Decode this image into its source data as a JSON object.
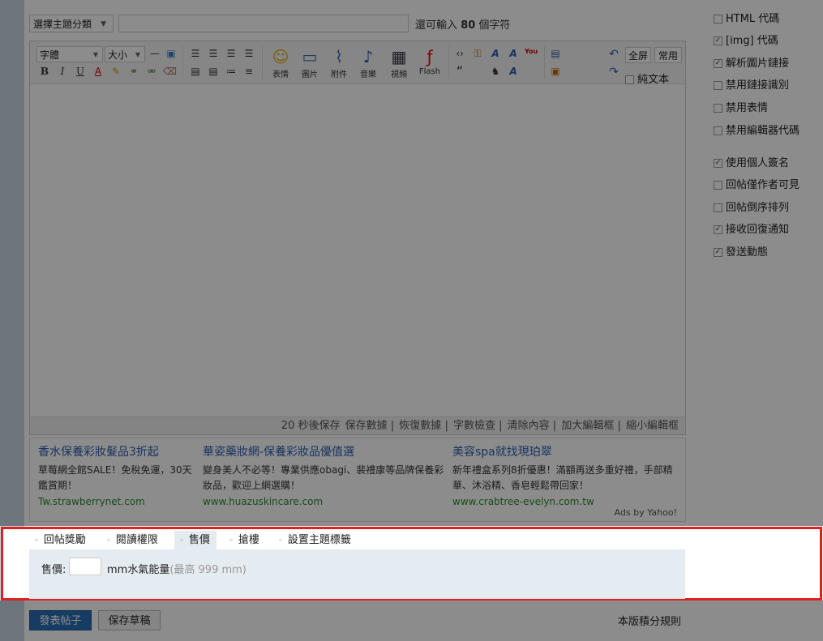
{
  "header": {
    "topic_select": "選擇主題分類",
    "char_remaining_prefix": "還可輸入",
    "char_remaining_count": "80",
    "char_remaining_suffix": "個字符"
  },
  "toolbar": {
    "font_select": "字體",
    "size_select": "大小",
    "buttons": [
      {
        "label": "表情",
        "icon": "smiley-icon"
      },
      {
        "label": "圖片",
        "icon": "image-icon"
      },
      {
        "label": "附件",
        "icon": "paperclip-icon"
      },
      {
        "label": "音樂",
        "icon": "music-note-icon"
      },
      {
        "label": "視頻",
        "icon": "video-icon"
      },
      {
        "label": "Flash",
        "icon": "flash-icon"
      }
    ],
    "fullscreen": "全屏",
    "common": "常用",
    "plain_text": "純文本"
  },
  "status_bar": {
    "autosave": "20 秒後保存",
    "save_data": "保存數據",
    "restore_data": "恢復數據",
    "word_check": "字數檢查",
    "clear_content": "清除內容",
    "enlarge": "加大編輯框",
    "shrink": "縮小編輯框"
  },
  "ads": [
    {
      "title": "香水保養彩妝髮品3折起",
      "desc": "草莓網全館SALE！免稅免運，30天鑑賞期！",
      "url": "Tw.strawberrynet.com"
    },
    {
      "title": "華姿藥妝網-保養彩妝品優值選",
      "desc": "變身美人不必等！專業供應obagi、裴禮康等品牌保養彩妝品，歡迎上網選購！",
      "url": "www.huazuskincare.com"
    },
    {
      "title": "美容spa就找現珀翠",
      "desc": "新年禮盒系列8折優惠！滿額再送多重好禮，手部精華、沐浴精、香皂輕鬆帶回家！",
      "url": "www.crabtree-evelyn.com.tw"
    }
  ],
  "ads_by": "Ads by Yahoo!",
  "options": [
    {
      "label": "HTML 代碼",
      "checked": false
    },
    {
      "label": "[img] 代碼",
      "checked": true
    },
    {
      "label": "解析圖片鏈接",
      "checked": true
    },
    {
      "label": "禁用鏈接識別",
      "checked": false
    },
    {
      "label": "禁用表情",
      "checked": false
    },
    {
      "label": "禁用編輯器代碼",
      "checked": false
    },
    {
      "label": "使用個人簽名",
      "checked": true
    },
    {
      "label": "回帖僅作者可見",
      "checked": false
    },
    {
      "label": "回帖倒序排列",
      "checked": false
    },
    {
      "label": "接收回復通知",
      "checked": true
    },
    {
      "label": "發送動態",
      "checked": true
    }
  ],
  "tabs": [
    {
      "label": "回帖獎勵",
      "active": false
    },
    {
      "label": "閱讀權限",
      "active": false
    },
    {
      "label": "售價",
      "active": true
    },
    {
      "label": "搶樓",
      "active": false
    },
    {
      "label": "設置主題標籤",
      "active": false
    }
  ],
  "price_panel": {
    "label": "售價:",
    "unit": "mm水氣能量",
    "max_note": "(最高 999 mm)"
  },
  "footer": {
    "post_button": "發表帖子",
    "draft_button": "保存草稿",
    "rules_link": "本版積分規則"
  },
  "colors": {
    "highlight_border": "#e02020",
    "panel_bg": "#e4ebf1",
    "post_button_bg": "#2a6db5"
  }
}
